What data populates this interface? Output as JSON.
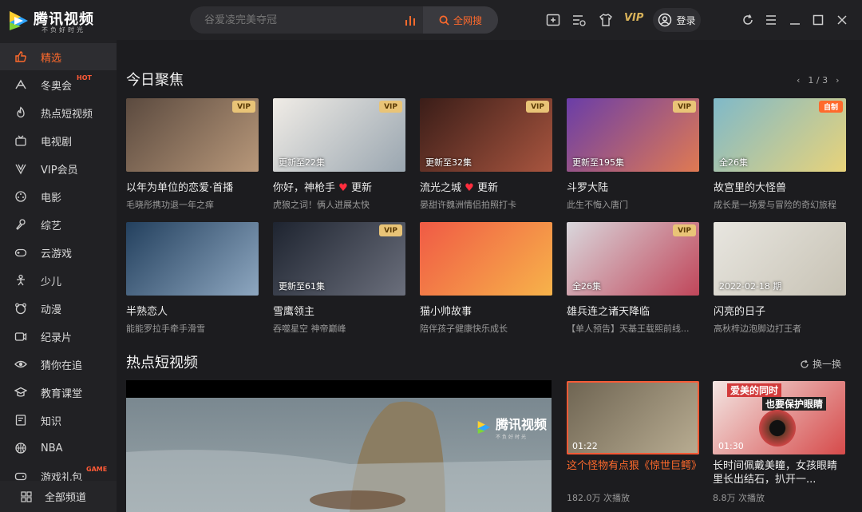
{
  "app": {
    "title": "腾讯视频",
    "slogan": "不负好时光"
  },
  "search": {
    "placeholder": "谷爱凌完美夺冠",
    "button_label": "全网搜"
  },
  "header": {
    "vip_label": "VIP",
    "login_label": "登录"
  },
  "sidebar": {
    "items": [
      {
        "label": "精选",
        "icon": "thumbs-up-icon",
        "active": true
      },
      {
        "label": "冬奥会",
        "icon": "olympics-icon",
        "badge": "HOT"
      },
      {
        "label": "热点短视频",
        "icon": "flame-icon"
      },
      {
        "label": "电视剧",
        "icon": "tv-icon"
      },
      {
        "label": "VIP会员",
        "icon": "vip-diamond-icon"
      },
      {
        "label": "电影",
        "icon": "film-reel-icon"
      },
      {
        "label": "综艺",
        "icon": "microphone-icon"
      },
      {
        "label": "云游戏",
        "icon": "gamepad-icon"
      },
      {
        "label": "少儿",
        "icon": "child-icon"
      },
      {
        "label": "动漫",
        "icon": "bear-face-icon"
      },
      {
        "label": "纪录片",
        "icon": "camera-icon"
      },
      {
        "label": "猜你在追",
        "icon": "eye-icon"
      },
      {
        "label": "教育课堂",
        "icon": "graduation-cap-icon"
      },
      {
        "label": "知识",
        "icon": "book-icon"
      },
      {
        "label": "NBA",
        "icon": "basketball-icon"
      },
      {
        "label": "游戏礼包",
        "icon": "game-gift-icon",
        "badge": "GAME"
      }
    ],
    "all_channels_label": "全部频道"
  },
  "today": {
    "title": "今日聚焦",
    "pager": "1 / 3",
    "cards": [
      {
        "title": "以年为单位的恋爱·首播",
        "sub": "毛晓彤携功退一年之痒",
        "badge": "VIP",
        "caption": "",
        "colors": [
          "#5b4a3f",
          "#b8987a"
        ]
      },
      {
        "title": "你好，神枪手",
        "title_suffix": "更新",
        "sub": "虎狼之词！俩人进展太快",
        "badge": "VIP",
        "caption": "更新至22集",
        "colors": [
          "#f0ece6",
          "#9aa6b0"
        ]
      },
      {
        "title": "流光之城",
        "title_suffix": "更新",
        "sub": "晏甜许魏洲情侣拍照打卡",
        "badge": "VIP",
        "caption": "更新至32集",
        "colors": [
          "#3a1d18",
          "#a8553f"
        ]
      },
      {
        "title": "斗罗大陆",
        "sub": "此生不悔入唐门",
        "badge": "VIP",
        "caption": "更新至195集",
        "colors": [
          "#6a3da8",
          "#e07a52"
        ]
      },
      {
        "title": "故宫里的大怪兽",
        "sub": "成长是一场爱与冒险的奇幻旅程",
        "badge": "自制",
        "caption": "全26集",
        "colors": [
          "#7fb9c9",
          "#e8d37a"
        ]
      },
      {
        "title": "半熟恋人",
        "sub": "能能罗拉手牵手滑雪",
        "badge": "",
        "caption": "",
        "colors": [
          "#23405e",
          "#8ea7c0"
        ]
      },
      {
        "title": "雪鹰领主",
        "sub": "吞噬星空 神帝巅峰",
        "badge": "VIP",
        "caption": "更新至61集",
        "colors": [
          "#1e2430",
          "#6b6f7c"
        ]
      },
      {
        "title": "猫小帅故事",
        "sub": "陪伴孩子健康快乐成长",
        "badge": "",
        "caption": "",
        "colors": [
          "#f05a45",
          "#f7b34a"
        ]
      },
      {
        "title": "雄兵连之诸天降临",
        "sub": "【单人预告】天基王载熙前线...",
        "badge": "VIP",
        "caption": "全26集",
        "colors": [
          "#d9d7dc",
          "#c0465a"
        ]
      },
      {
        "title": "闪亮的日子",
        "sub": "高秋梓边泡脚边打王者",
        "badge": "",
        "caption": "2022-02-18 期",
        "colors": [
          "#e8e6e0",
          "#c7c2b4"
        ]
      }
    ]
  },
  "hot_shorts": {
    "title": "热点短视频",
    "refresh_label": "换一换",
    "watermark_title": "腾讯视频",
    "watermark_slogan": "不负好时光",
    "items": [
      {
        "title": "这个怪物有点狠《惊世巨鳄》",
        "views": "182.0万 次播放",
        "duration": "01:22",
        "selected": true,
        "colors": [
          "#6e6452",
          "#b9ad92"
        ]
      },
      {
        "title": "长时间佩戴美瞳，女孩眼睛里长出结石，扒开一...",
        "views": "8.8万 次播放",
        "duration": "01:30",
        "selected": false,
        "colors": [
          "#f3e6e3",
          "#d64a4a"
        ],
        "top_text": "爱美的同时",
        "mid_text": "也要保护眼睛"
      }
    ]
  },
  "colors": {
    "accent": "#ff6a2c",
    "vip_gold": "#e9c477",
    "background": "#1c1c1f",
    "sidebar": "#212124"
  }
}
